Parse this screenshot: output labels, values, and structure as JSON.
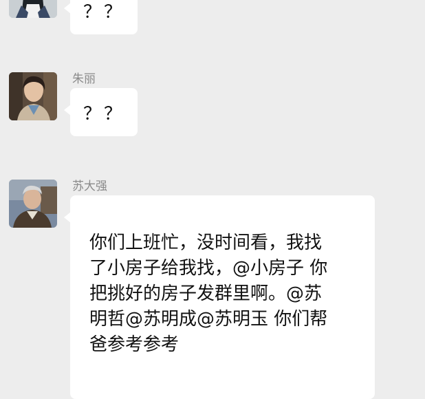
{
  "messages": [
    {
      "sender": "",
      "avatar_icon": "woman-dark-hair-avatar-icon",
      "text": "？？"
    },
    {
      "sender": "朱丽",
      "avatar_icon": "woman-portrait-avatar-icon",
      "text": "？？"
    },
    {
      "sender": "苏大强",
      "avatar_icon": "old-man-portrait-avatar-icon",
      "text": "你们上班忙，没时间看，我找\n了小房子给我找，@小房子  你\n把挑好的房子发群里啊。@苏\n明哲@苏明成@苏明玉  你们帮\n爸参考参考"
    }
  ],
  "colors": {
    "background": "#ededed",
    "bubble": "#ffffff",
    "sender_name": "#8a8a8a"
  }
}
